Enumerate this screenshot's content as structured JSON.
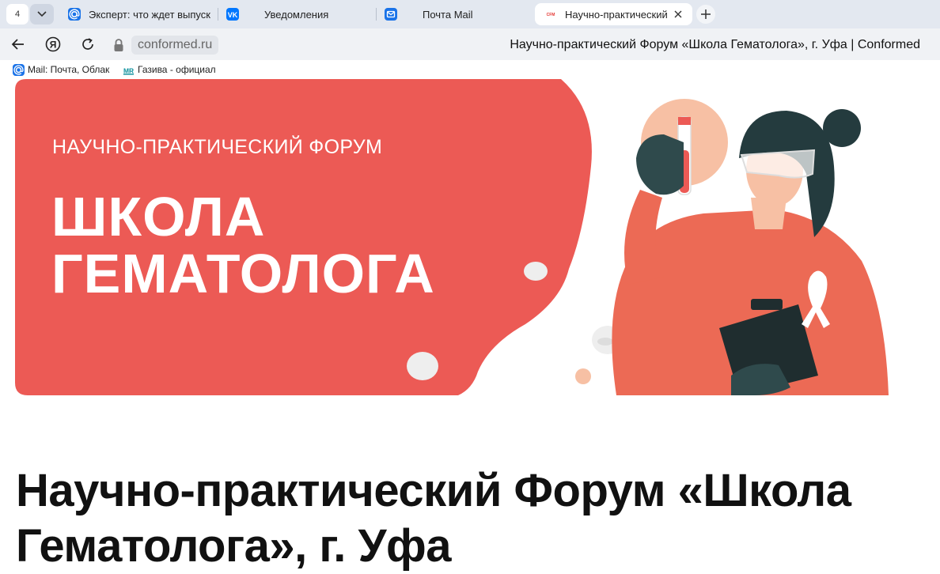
{
  "browser": {
    "tab_count": "4",
    "tabs": [
      {
        "title": "Эксперт: что ждет выпуск",
        "icon": "at-icon"
      },
      {
        "title": "Уведомления",
        "icon": "vk-icon"
      },
      {
        "title": "Почта Mail",
        "icon": "mail-icon"
      },
      {
        "title": "Научно-практический",
        "icon": "site-favicon",
        "active": true
      }
    ],
    "address": {
      "domain": "conformed.ru",
      "page_title": "Научно-практический Форум «Школа Гематолога», г. Уфа | Conformed"
    },
    "bookmarks": [
      {
        "label": "Mail: Почта, Облак",
        "icon": "at-icon"
      },
      {
        "label": "Газива - официал",
        "icon": "mr-icon"
      }
    ],
    "colors": {
      "accent_coral": "#ec5a55",
      "tabstrip": "#e3e8f0"
    }
  },
  "banner": {
    "subtitle": "НАУЧНО-ПРАКТИЧЕСКИЙ ФОРУМ",
    "title_line1": "ШКОЛА",
    "title_line2": "ГЕМАТОЛОГА"
  },
  "page": {
    "heading": "Научно-практический Форум «Школа Гематолога», г. Уфа"
  }
}
